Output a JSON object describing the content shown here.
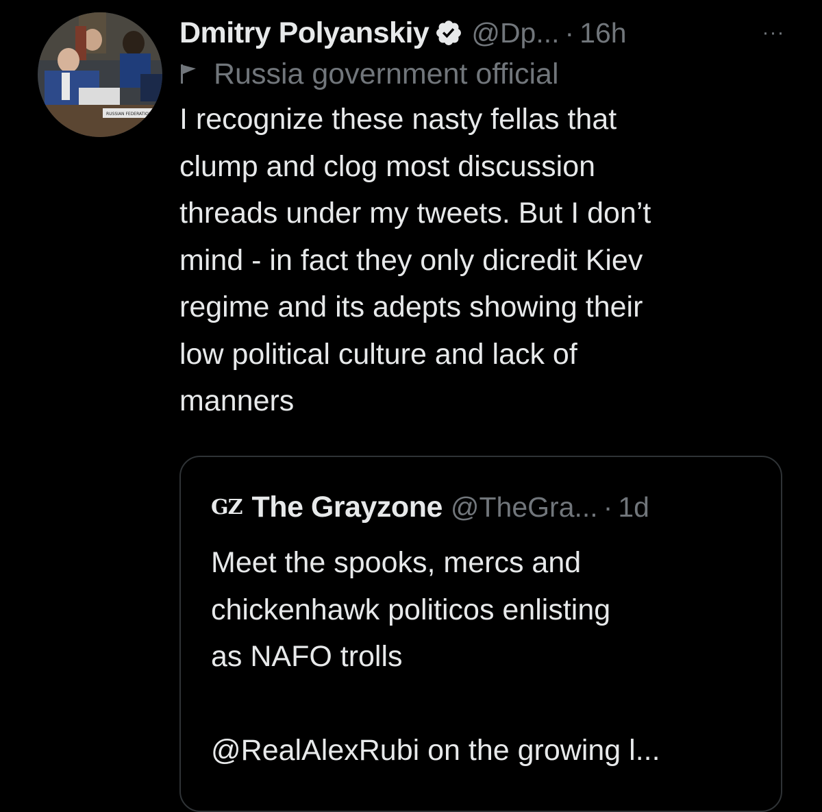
{
  "tweet": {
    "display_name": "Dmitry Polyanskiy",
    "handle": "@Dp...",
    "separator": "·",
    "time": "16h",
    "more_icon": "more-horizontal-icon",
    "more_label": "···",
    "label_text": "Russia government official",
    "avatar_caption": "RUSSIAN FEDERATION",
    "body_lines": [
      "I recognize these nasty fellas that",
      "clump and clog most discussion",
      "threads under my tweets. But I don’t",
      "mind - in fact they only dicredit Kiev",
      "regime and its adepts showing their",
      "low political culture and lack of",
      "manners"
    ]
  },
  "quote": {
    "logo": "GZ",
    "display_name": "The Grayzone",
    "handle": "@TheGra...",
    "separator": "·",
    "time": "1d",
    "body_lines": [
      "Meet the spooks, mercs and",
      "chickenhawk politicos enlisting",
      "as NAFO trolls"
    ],
    "body_continued": "@RealAlexRubi on the growing l..."
  },
  "colors": {
    "background": "#000000",
    "text_primary": "#e7e9ea",
    "text_secondary": "#71767b",
    "border": "#2f3336"
  }
}
